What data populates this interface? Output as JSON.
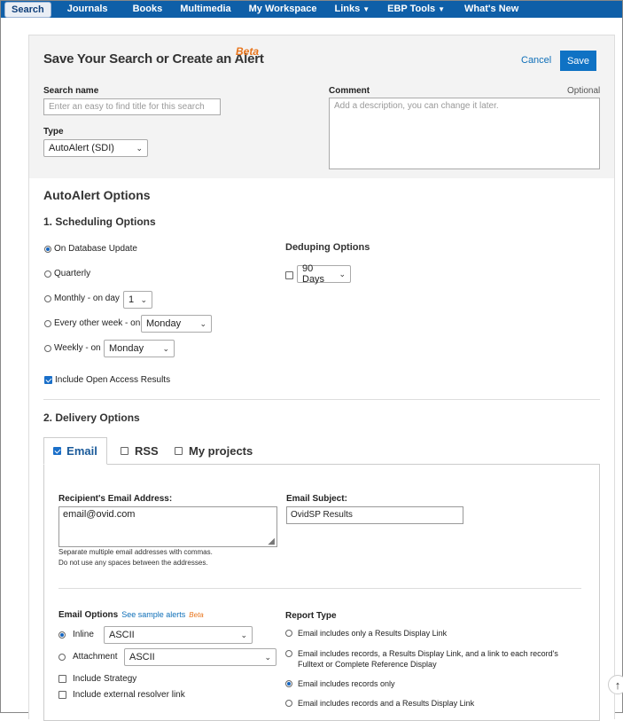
{
  "nav": {
    "items": [
      {
        "label": "Search",
        "active": true
      },
      {
        "label": "Journals"
      },
      {
        "label": "Books"
      },
      {
        "label": "Multimedia"
      },
      {
        "label": "My Workspace"
      },
      {
        "label": "Links",
        "caret": true
      },
      {
        "label": "EBP Tools",
        "caret": true
      },
      {
        "label": "What's New"
      }
    ]
  },
  "header": {
    "title": "Save Your Search or Create an Alert",
    "beta": "Beta",
    "cancel_label": "Cancel",
    "save_label": "Save",
    "search_name_label": "Search name",
    "search_name_placeholder": "Enter an easy to find title for this search",
    "type_label": "Type",
    "type_value": "AutoAlert (SDI)",
    "comment_label": "Comment",
    "comment_optional": "Optional",
    "comment_placeholder": "Add a description, you can change it later."
  },
  "autoalert": {
    "title": "AutoAlert Options",
    "scheduling_title": "1. Scheduling Options",
    "schedule_options": {
      "db_update": "On Database Update",
      "quarterly": "Quarterly",
      "monthly": "Monthly - on day",
      "monthly_value": "1",
      "every_other_week": "Every other week - on",
      "every_other_week_value": "Monday",
      "weekly": "Weekly - on",
      "weekly_value": "Monday"
    },
    "include_open_access": "Include Open Access Results",
    "deduping_title": "Deduping Options",
    "deduping_value": "90 Days"
  },
  "delivery": {
    "title": "2. Delivery Options",
    "tabs": {
      "email": "Email",
      "rss": "RSS",
      "projects": "My projects"
    },
    "recipient_label": "Recipient's Email Address:",
    "recipient_value": "email@ovid.com",
    "recipient_help1": "Separate multiple email addresses with commas.",
    "recipient_help2": "Do not use any spaces between the addresses.",
    "subject_label": "Email Subject:",
    "subject_value": "OvidSP Results",
    "email_options_label": "Email Options",
    "see_sample": "See sample alerts",
    "beta": "Beta",
    "inline_label": "Inline",
    "inline_value": "ASCII",
    "attachment_label": "Attachment",
    "attachment_value": "ASCII",
    "include_strategy": "Include Strategy",
    "include_resolver": "Include external resolver link",
    "report_type_label": "Report Type",
    "report_types": {
      "r1": "Email includes only a Results Display Link",
      "r2a": "Email includes records, a Results Display Link, and a link to each record's",
      "r2b": "Fulltext or Complete Reference Display",
      "r3": "Email includes records only",
      "r4": "Email includes records and a Results Display Link"
    }
  }
}
